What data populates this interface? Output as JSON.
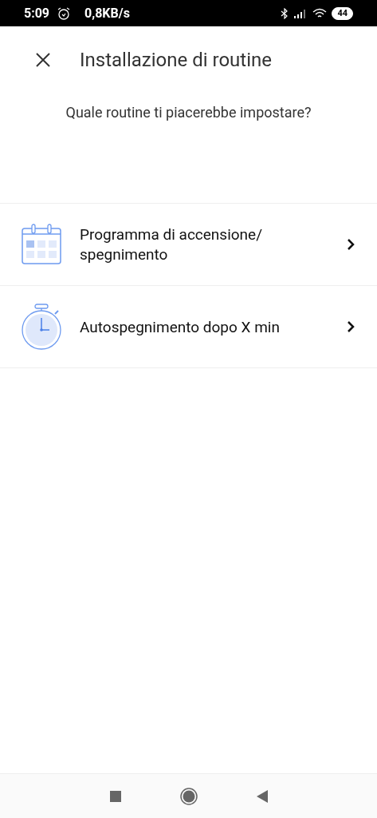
{
  "status_bar": {
    "time": "5:09",
    "speed": "0,8KB/s",
    "battery": "44"
  },
  "header": {
    "title": "Installazione di routine"
  },
  "prompt": "Quale routine ti piacerebbe impostare?",
  "routines": [
    {
      "kind": "calendar",
      "label": "Programma di accensione/ spegnimento"
    },
    {
      "kind": "timer",
      "label": "Autospegnimento dopo X min"
    }
  ]
}
